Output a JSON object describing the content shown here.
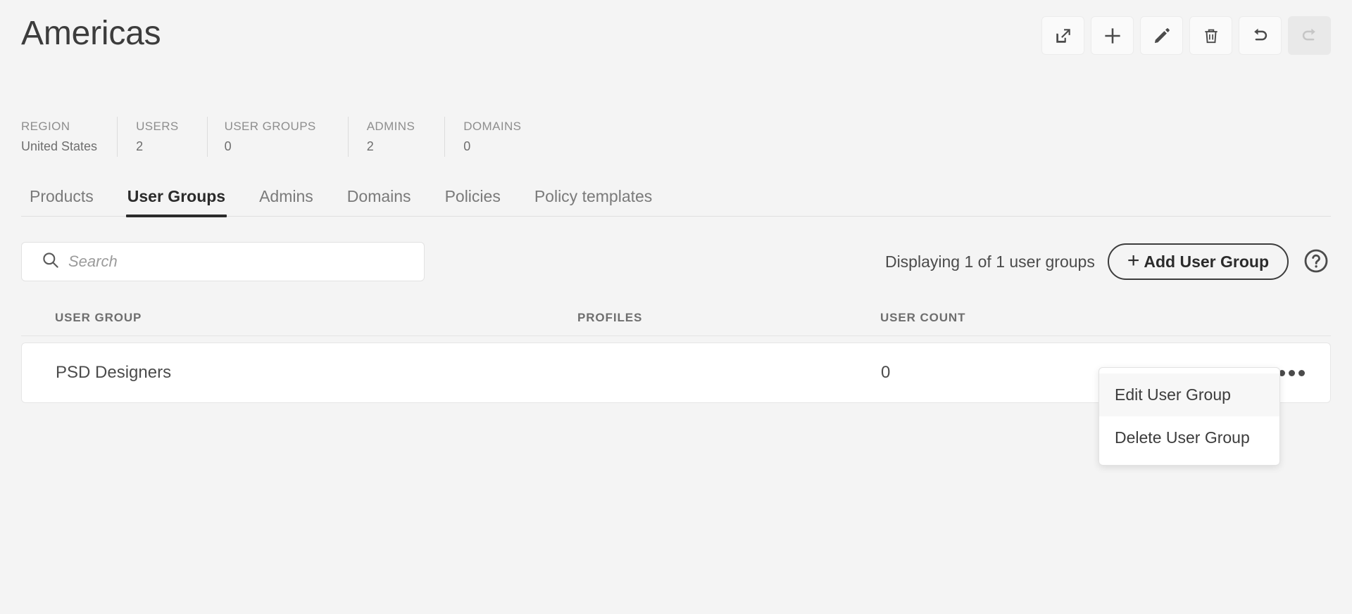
{
  "header": {
    "title": "Americas",
    "toolbar": [
      {
        "name": "export-button",
        "icon": "export-icon",
        "disabled": false
      },
      {
        "name": "add-button",
        "icon": "plus-icon",
        "disabled": false
      },
      {
        "name": "edit-button",
        "icon": "pencil-icon",
        "disabled": false
      },
      {
        "name": "delete-button",
        "icon": "trash-icon",
        "disabled": false
      },
      {
        "name": "undo-button",
        "icon": "undo-icon",
        "disabled": false
      },
      {
        "name": "redo-button",
        "icon": "redo-icon",
        "disabled": true
      }
    ]
  },
  "stats": [
    {
      "label": "REGION",
      "value": "United States"
    },
    {
      "label": "USERS",
      "value": "2"
    },
    {
      "label": "USER GROUPS",
      "value": "0"
    },
    {
      "label": "ADMINS",
      "value": "2"
    },
    {
      "label": "DOMAINS",
      "value": "0"
    }
  ],
  "tabs": [
    {
      "label": "Products",
      "active": false
    },
    {
      "label": "User Groups",
      "active": true
    },
    {
      "label": "Admins",
      "active": false
    },
    {
      "label": "Domains",
      "active": false
    },
    {
      "label": "Policies",
      "active": false
    },
    {
      "label": "Policy templates",
      "active": false
    }
  ],
  "controls": {
    "search_placeholder": "Search",
    "search_value": "",
    "displaying_text": "Displaying 1 of 1 user groups",
    "add_button_label": "Add User Group",
    "add_button_plus": "+",
    "help_icon": "question-circle-icon"
  },
  "table": {
    "columns": [
      "USER GROUP",
      "PROFILES",
      "USER COUNT"
    ],
    "rows": [
      {
        "user_group": "PSD Designers",
        "profiles": "",
        "user_count": "0"
      }
    ]
  },
  "context_menu": {
    "items": [
      {
        "label": "Edit User Group",
        "highlighted": true
      },
      {
        "label": "Delete User Group",
        "highlighted": false
      }
    ]
  },
  "colors": {
    "background": "#f4f4f4",
    "surface": "#ffffff",
    "text": "#4b4b4b",
    "muted": "#8e8e8e",
    "accent": "#2b2b2b",
    "border": "#e2e2e2"
  }
}
